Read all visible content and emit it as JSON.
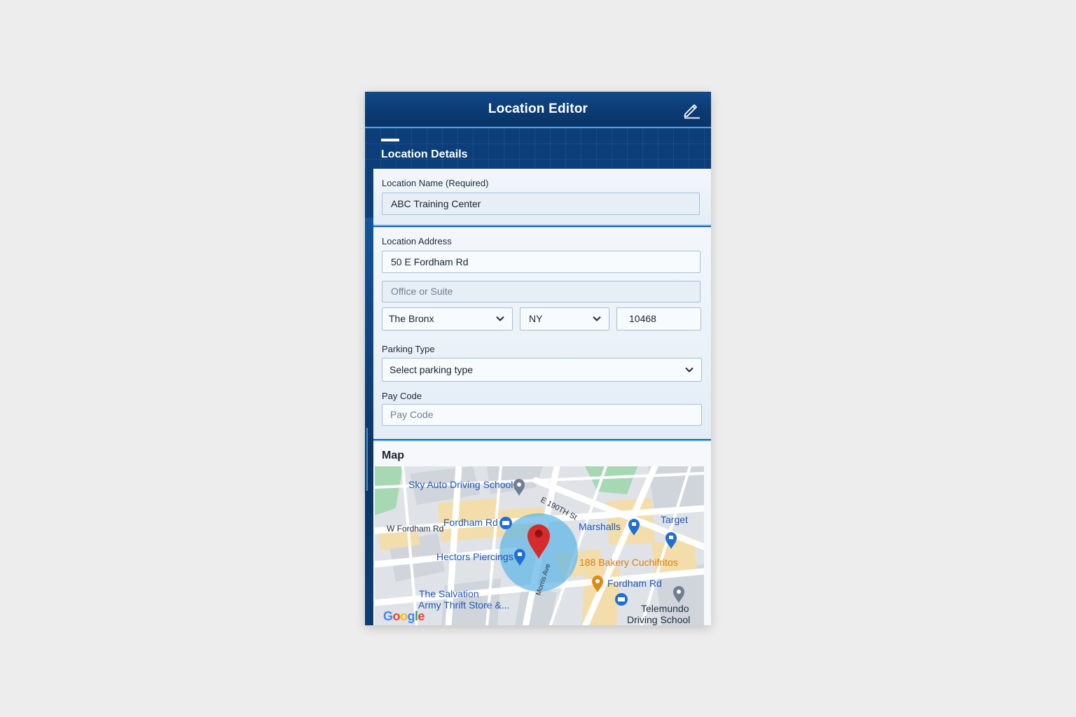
{
  "header": {
    "title": "Location Editor",
    "edit_icon": "pencil-icon"
  },
  "section": {
    "title": "Location Details",
    "collapse_icon": "minus-icon"
  },
  "location_name": {
    "label": "Location Name (Required)",
    "value": "ABC Training Center"
  },
  "address": {
    "label": "Location Address",
    "street_value": "50 E Fordham Rd",
    "suite_placeholder": "Office or Suite",
    "city_value": "The Bronx",
    "state_value": "NY",
    "zip_value": "10468"
  },
  "parking": {
    "label": "Parking Type",
    "selected": "Select parking type"
  },
  "pay_code": {
    "label": "Pay Code",
    "placeholder": "Pay Code"
  },
  "map": {
    "title": "Map",
    "places": {
      "sky_auto": "Sky Auto Driving School",
      "e_190": "E 190TH St",
      "w_fordham": "W Fordham Rd",
      "fordham_rd_station": "Fordham Rd",
      "marshalls": "Marshalls",
      "target": "Target",
      "hectors": "Hectors Piercings",
      "bakery": "188 Bakery Cuchifritos",
      "fordham_rd_2": "Fordham Rd",
      "salvation_1": "The Salvation",
      "salvation_2": "Army Thrift Store &...",
      "telemundo_1": "Telemundo",
      "telemundo_2": "Driving School",
      "ave": "Morris Ave"
    },
    "google": [
      "G",
      "o",
      "o",
      "g",
      "l",
      "e"
    ],
    "colors": {
      "accent": "#2a73d9",
      "pin_red": "#d52b2b",
      "radius_fill": "#5fb6e6",
      "orange": "#e08a16"
    }
  }
}
